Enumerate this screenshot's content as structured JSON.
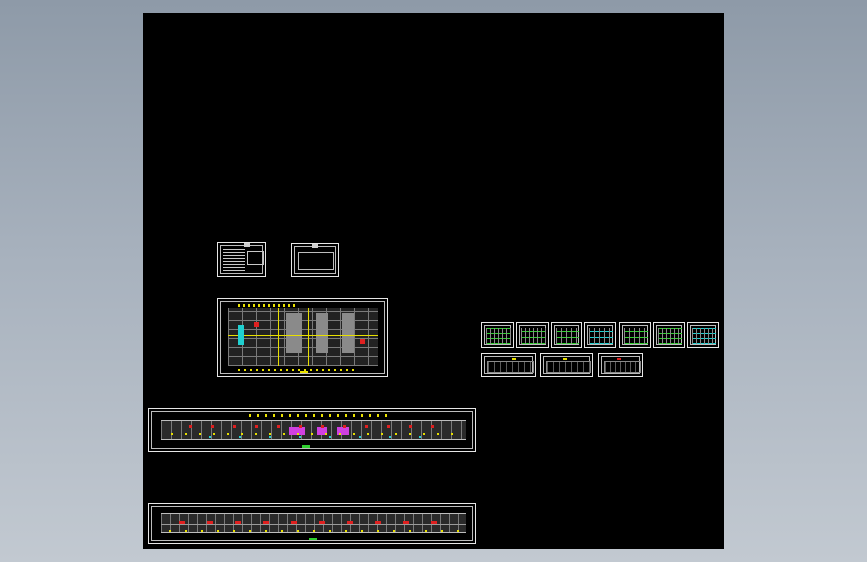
{
  "viewer": {
    "background_gradient": [
      "#8e9aa8",
      "#c2c9d1"
    ],
    "canvas_color": "#000000"
  },
  "sheets": [
    {
      "id": "cover-notes-sheet"
    },
    {
      "id": "title-sheet"
    },
    {
      "id": "floor-plan-sheet"
    },
    {
      "id": "long-elevation-sheet-1"
    },
    {
      "id": "long-elevation-sheet-2"
    },
    {
      "id": "detail-sheet-1"
    },
    {
      "id": "detail-sheet-2"
    },
    {
      "id": "detail-sheet-3"
    },
    {
      "id": "detail-sheet-4"
    },
    {
      "id": "detail-sheet-5"
    },
    {
      "id": "detail-sheet-6"
    },
    {
      "id": "detail-sheet-7"
    },
    {
      "id": "section-sheet-1"
    },
    {
      "id": "section-sheet-2"
    },
    {
      "id": "section-sheet-3"
    }
  ],
  "palette": {
    "frame": "#e6e6e6",
    "grid": "#8a8a8a",
    "yellow": "#e8e000",
    "red": "#e02020",
    "magenta": "#d040e0",
    "cyan": "#20d0d0",
    "green": "#30d030",
    "blue": "#4060ff"
  }
}
